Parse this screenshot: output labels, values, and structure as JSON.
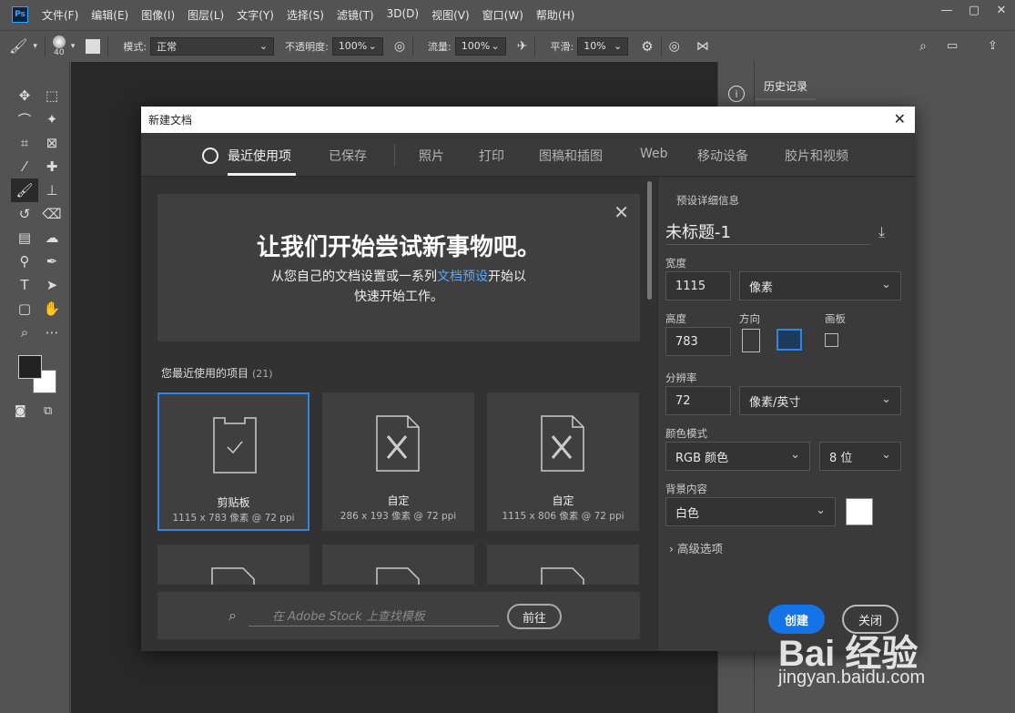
{
  "app": {
    "logo_text": "Ps"
  },
  "menubar": {
    "items": [
      "文件(F)",
      "编辑(E)",
      "图像(I)",
      "图层(L)",
      "文字(Y)",
      "选择(S)",
      "滤镜(T)",
      "3D(D)",
      "视图(V)",
      "窗口(W)",
      "帮助(H)"
    ],
    "window_buttons": [
      "—",
      "▢",
      "✕"
    ]
  },
  "options": {
    "brush_size": "40",
    "mode_label": "模式:",
    "mode_value": "正常",
    "opacity_label": "不透明度:",
    "opacity_value": "100%",
    "flow_label": "流量:",
    "flow_value": "100%",
    "smooth_label": "平滑:",
    "smooth_value": "10%"
  },
  "panels": {
    "history_tab": "历史记录"
  },
  "dialog": {
    "title": "新建文档",
    "tabs": [
      "最近使用项",
      "已保存",
      "照片",
      "打印",
      "图稿和插图",
      "Web",
      "移动设备",
      "胶片和视频"
    ],
    "welcome": {
      "heading": "让我们开始尝试新事物吧。",
      "line1_prefix": "从您自己的文档设置或一系列",
      "line1_link": "文档预设",
      "line1_suffix": "开始以",
      "line2": "快速开始工作。"
    },
    "recent": {
      "label": "您最近使用的项目",
      "count": "(21)",
      "items": [
        {
          "name": "剪贴板",
          "size": "1115 x 783 像素 @ 72 ppi"
        },
        {
          "name": "自定",
          "size": "286 x 193 像素 @ 72 ppi"
        },
        {
          "name": "自定",
          "size": "1115 x 806 像素 @ 72 ppi"
        }
      ]
    },
    "stock": {
      "placeholder": "在 Adobe Stock 上查找模板",
      "go": "前往"
    },
    "preset": {
      "section_title": "预设详细信息",
      "doc_name": "未标题-1",
      "width_label": "宽度",
      "width_value": "1115",
      "width_unit": "像素",
      "height_label": "高度",
      "height_value": "783",
      "orientation_label": "方向",
      "artboard_label": "画板",
      "resolution_label": "分辨率",
      "resolution_value": "72",
      "resolution_unit": "像素/英寸",
      "colormode_label": "颜色模式",
      "colormode_value": "RGB 颜色",
      "bitdepth_value": "8 位",
      "background_label": "背景内容",
      "background_value": "白色",
      "advanced": "高级选项",
      "create": "创建",
      "close": "关闭"
    }
  },
  "watermark": {
    "logo": "Bai  经验",
    "url": "jingyan.baidu.com"
  }
}
